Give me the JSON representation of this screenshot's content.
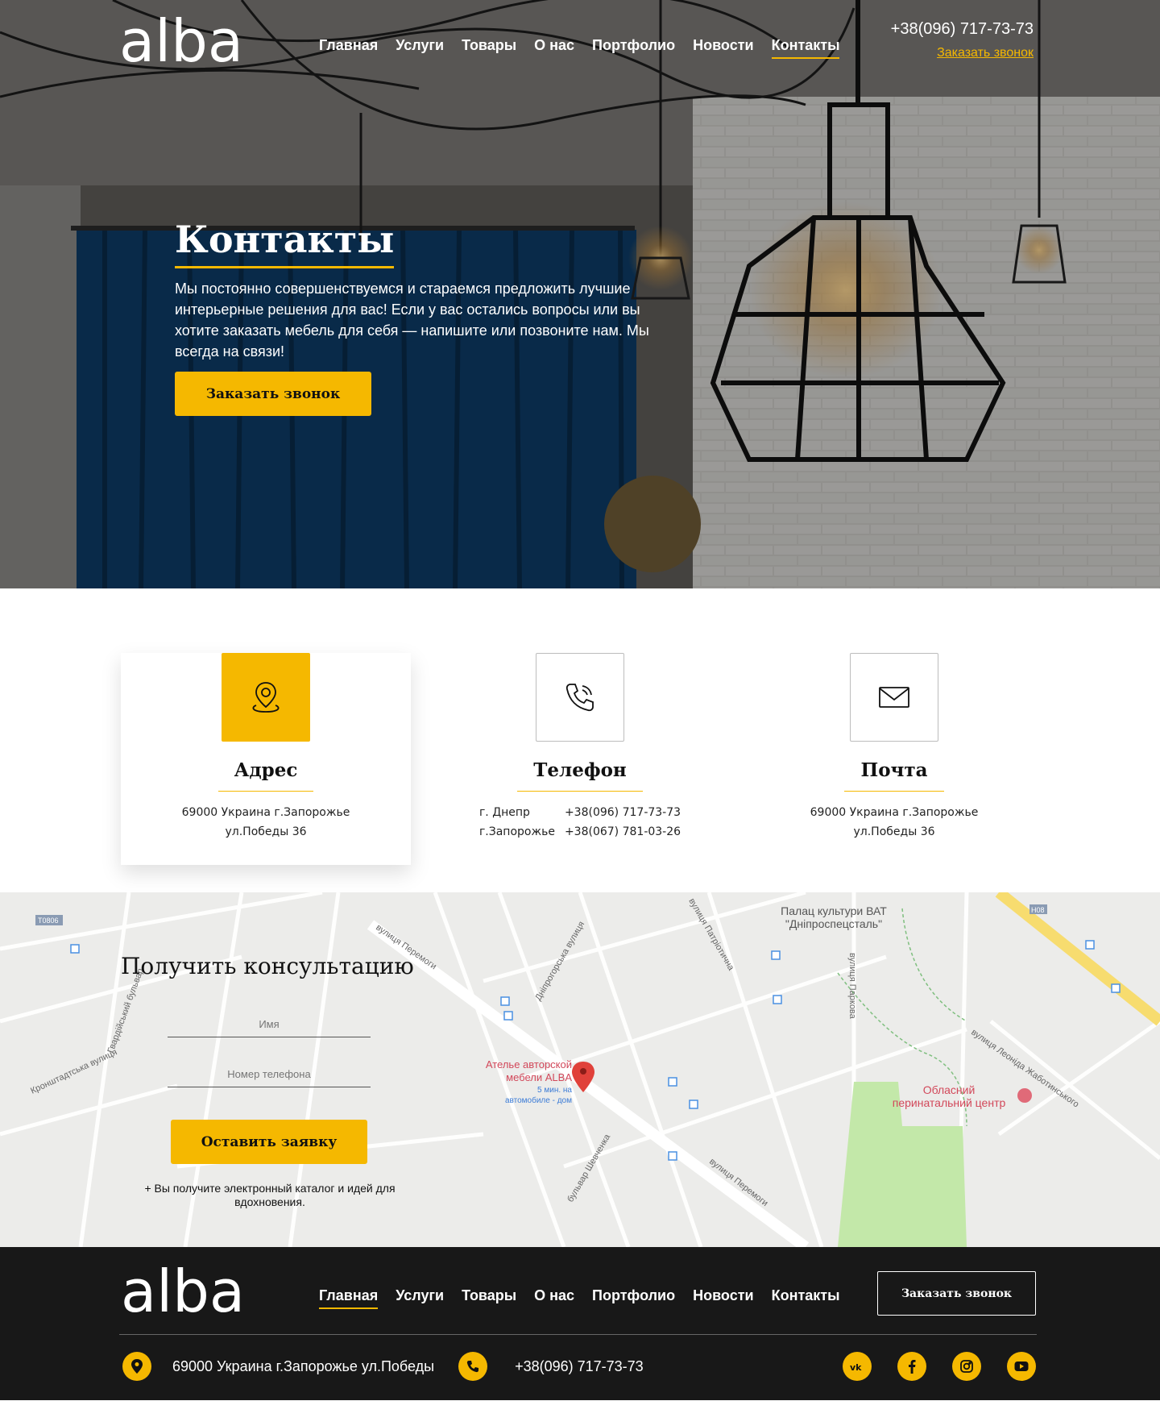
{
  "header": {
    "logo": "alba",
    "nav": [
      "Главная",
      "Услуги",
      "Товары",
      "О нас",
      "Портфолио",
      "Новости",
      "Контакты"
    ],
    "active_nav": "Контакты",
    "phone": "+38(096) 717-73-73",
    "call_link": "Заказать звонок"
  },
  "hero": {
    "title": "Контакты",
    "text": "Мы постоянно совершенствуемся и стараемся предложить лучшие интерьерные решения для вас! Если у вас остались вопросы или вы хотите заказать мебель для себя — напишите или позвоните нам. Мы всегда на связи!",
    "button": "Заказать звонок"
  },
  "cards": {
    "address": {
      "icon": "location-pin-icon",
      "title": "Адрес",
      "line1": "69000 Украина г.Запорожье",
      "line2": "ул.Победы 36"
    },
    "phone": {
      "icon": "phone-icon",
      "title": "Телефон",
      "rows": [
        {
          "city": "г. Днепр",
          "number": "+38(096) 717-73-73"
        },
        {
          "city": "г.Запорожье",
          "number": "+38(067) 781-03-26"
        }
      ]
    },
    "mail": {
      "icon": "envelope-icon",
      "title": "Почта",
      "line1": "69000 Украина г.Запорожье",
      "line2": "ул.Победы 36"
    }
  },
  "form": {
    "title": "Получить консультацию",
    "name_placeholder": "Имя",
    "phone_placeholder": "Номер телефона",
    "button": "Оставить заявку",
    "note": "+ Вы получите электронный каталог и идей для вдохновения."
  },
  "map": {
    "marker_label_1": "Ателье авторской",
    "marker_label_2": "мебели ALBA",
    "marker_sub_1": "5 мин. на",
    "marker_sub_2": "автомобиле - дом",
    "poi_1_a": "Палац культури ВАТ",
    "poi_1_b": "\"Дніпроспецсталь\"",
    "poi_2_a": "Обласний",
    "poi_2_b": "перинатальний центр",
    "street_1": "вулиця Перемоги",
    "street_2": "вулиця Перемоги",
    "street_3": "бульвар Шевченка",
    "street_4": "вулиця Паркова",
    "street_5": "вулиця Патріотична",
    "street_6": "Дніпрогорська вулиця",
    "street_7": "вулиця Леоніда Жаботинського",
    "street_8": "Гвардійський бульвар",
    "street_9": "Кронштадтська вулиця",
    "road_1": "T0806",
    "road_2": "H08"
  },
  "footer": {
    "logo": "alba",
    "nav": [
      "Главная",
      "Услуги",
      "Товары",
      "О нас",
      "Портфолио",
      "Новости",
      "Контакты"
    ],
    "active_nav": "Главная",
    "button": "Заказать звонок",
    "address": "69000 Украина г.Запорожье ул.Победы",
    "phone": "+38(096) 717-73-73",
    "socials": [
      "vk-icon",
      "facebook-icon",
      "instagram-icon",
      "youtube-icon"
    ]
  },
  "colors": {
    "accent": "#f5b800",
    "footer_bg": "#181818",
    "map_bg": "#ececea"
  }
}
